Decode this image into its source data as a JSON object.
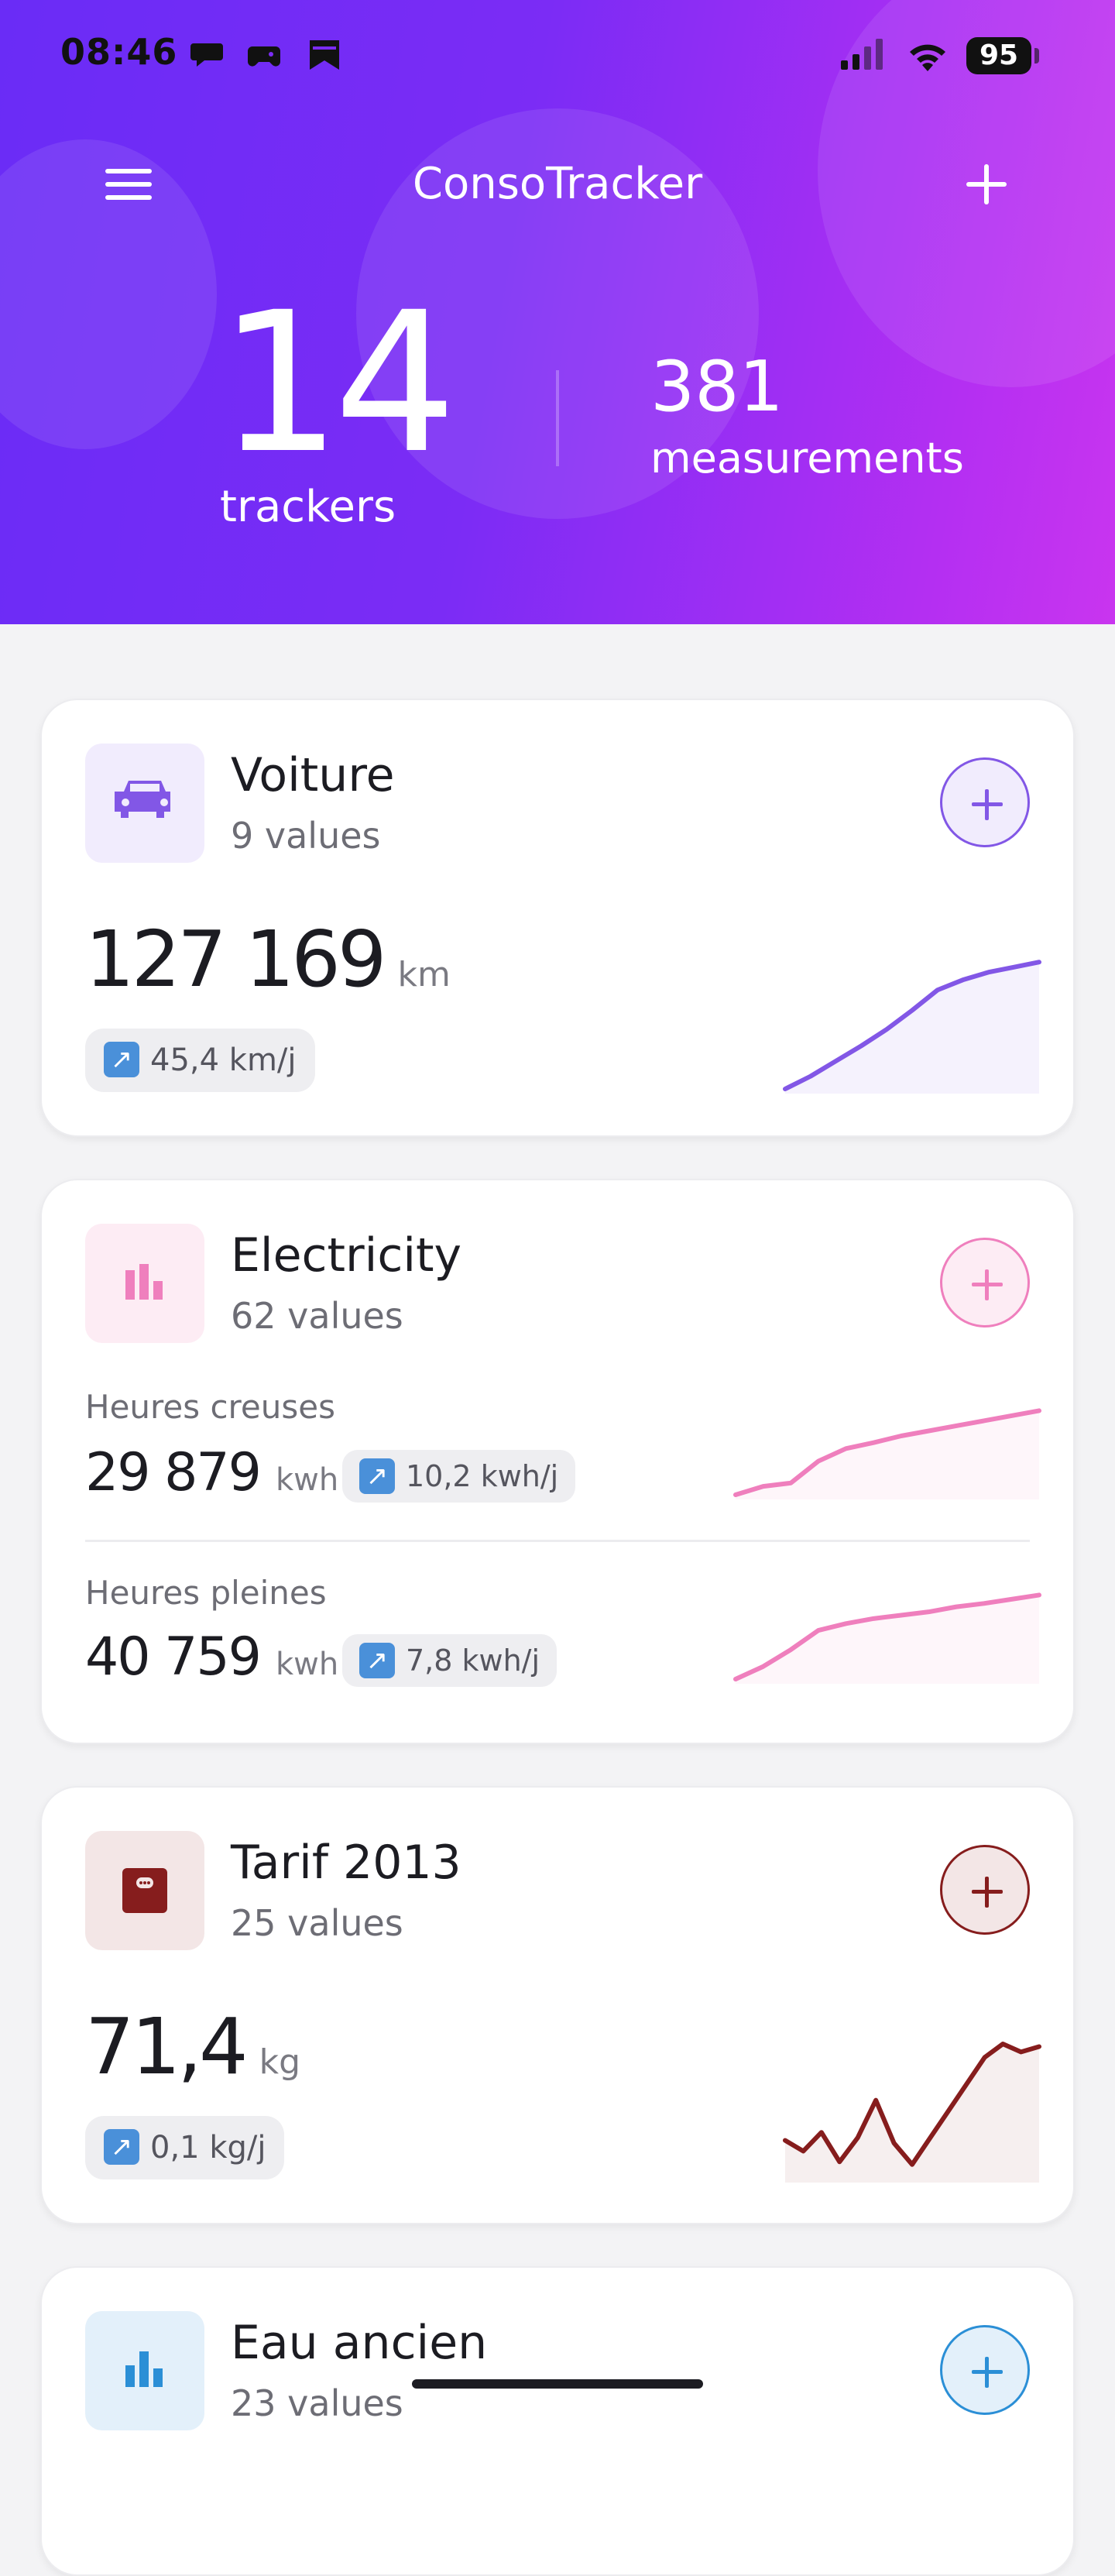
{
  "status_bar": {
    "time": "08:46",
    "battery": "95",
    "icons": [
      "chat-bubble-icon",
      "game-controller-icon",
      "bookmark-icon",
      "signal-icon",
      "wifi-icon",
      "battery-icon"
    ]
  },
  "header": {
    "title": "ConsoTracker",
    "menu_icon": "hamburger-menu-icon",
    "add_icon": "plus-icon",
    "trackers_count": "14",
    "trackers_label": "trackers",
    "measurements_count": "381",
    "measurements_label": "measurements",
    "gradient": [
      "#6a2cf6",
      "#c935ef"
    ]
  },
  "trackers": [
    {
      "name": "Voiture",
      "count_text": "9 values",
      "icon": "car-icon",
      "accent": "#8257e6",
      "icon_bg": "#f1ecfd",
      "value": "127 169",
      "unit": "km",
      "rate": "45,4 km/j",
      "spark": [
        0.0,
        0.1,
        0.22,
        0.34,
        0.47,
        0.62,
        0.78,
        0.86,
        0.92,
        0.96,
        1.0
      ]
    },
    {
      "name": "Electricity",
      "count_text": "62 values",
      "icon": "bar-chart-icon",
      "accent": "#ef7fbd",
      "icon_bg": "#fdecf4",
      "subs": [
        {
          "label": "Heures creuses",
          "value": "29 879",
          "unit": "kwh",
          "rate": "10,2 kwh/j",
          "spark": [
            0.0,
            0.1,
            0.14,
            0.4,
            0.55,
            0.62,
            0.7,
            0.76,
            0.82,
            0.88,
            0.94,
            1.0
          ]
        },
        {
          "label": "Heures pleines",
          "value": "40 759",
          "unit": "kwh",
          "rate": "7,8 kwh/j",
          "spark": [
            0.0,
            0.15,
            0.35,
            0.58,
            0.66,
            0.72,
            0.76,
            0.8,
            0.86,
            0.9,
            0.95,
            1.0
          ]
        }
      ]
    },
    {
      "name": "Tarif 2013",
      "count_text": "25 values",
      "icon": "scale-icon",
      "accent": "#861d1d",
      "icon_bg": "#f3e6e6",
      "value": "71,4",
      "unit": "kg",
      "rate": "0,1 kg/j",
      "spark": [
        0.28,
        0.2,
        0.34,
        0.12,
        0.3,
        0.58,
        0.26,
        0.1,
        0.3,
        0.5,
        0.7,
        0.9,
        1.0,
        0.94,
        0.98
      ]
    },
    {
      "name": "Eau ancien",
      "count_text": "23 values",
      "icon": "bar-chart-icon",
      "accent": "#2b8fd6",
      "icon_bg": "#e3f0fa"
    }
  ]
}
